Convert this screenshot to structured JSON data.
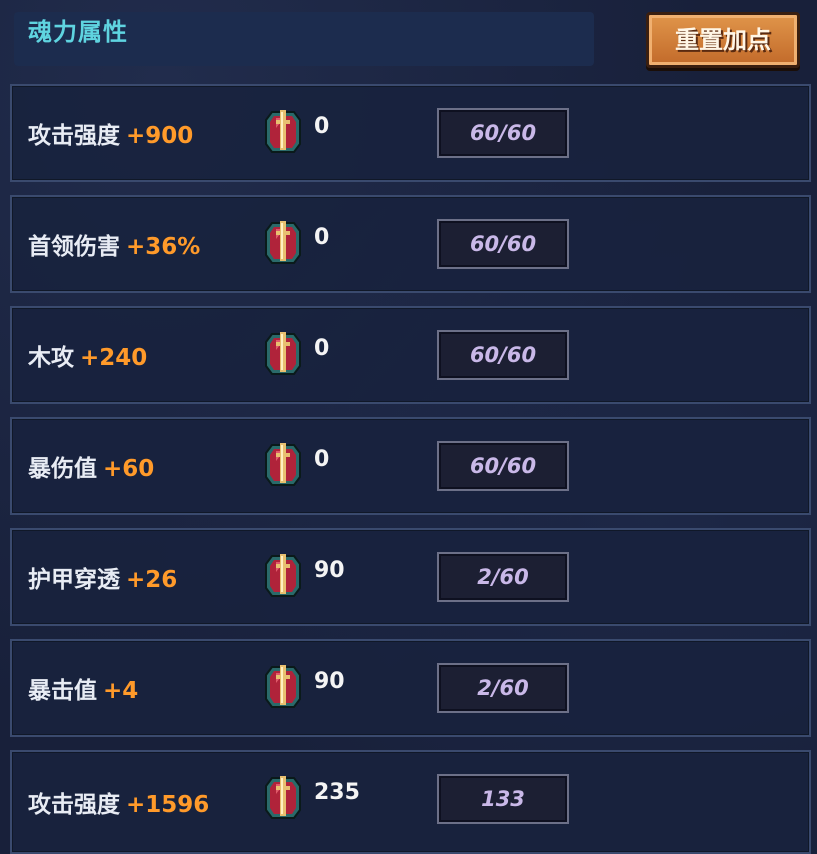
{
  "header": {
    "title": "魂力属性",
    "reset_label": "重置加点"
  },
  "stats": [
    {
      "name": "攻击强度",
      "bonus": "+900",
      "gem_count": "0",
      "progress": "60/60"
    },
    {
      "name": "首领伤害",
      "bonus": "+36%",
      "gem_count": "0",
      "progress": "60/60"
    },
    {
      "name": "木攻",
      "bonus": "+240",
      "gem_count": "0",
      "progress": "60/60"
    },
    {
      "name": "暴伤值",
      "bonus": "+60",
      "gem_count": "0",
      "progress": "60/60"
    },
    {
      "name": "护甲穿透",
      "bonus": "+26",
      "gem_count": "90",
      "progress": "2/60"
    },
    {
      "name": "暴击值",
      "bonus": "+4",
      "gem_count": "90",
      "progress": "2/60"
    },
    {
      "name": "攻击强度",
      "bonus": "+1596",
      "gem_count": "235",
      "progress": "133"
    }
  ],
  "colors": {
    "title": "#5fd4e0",
    "bonus": "#ff9a2a",
    "button": "#d07a34",
    "progress_text": "#c9b8e8"
  },
  "icons": {
    "gem": "soul-crystal-icon"
  }
}
